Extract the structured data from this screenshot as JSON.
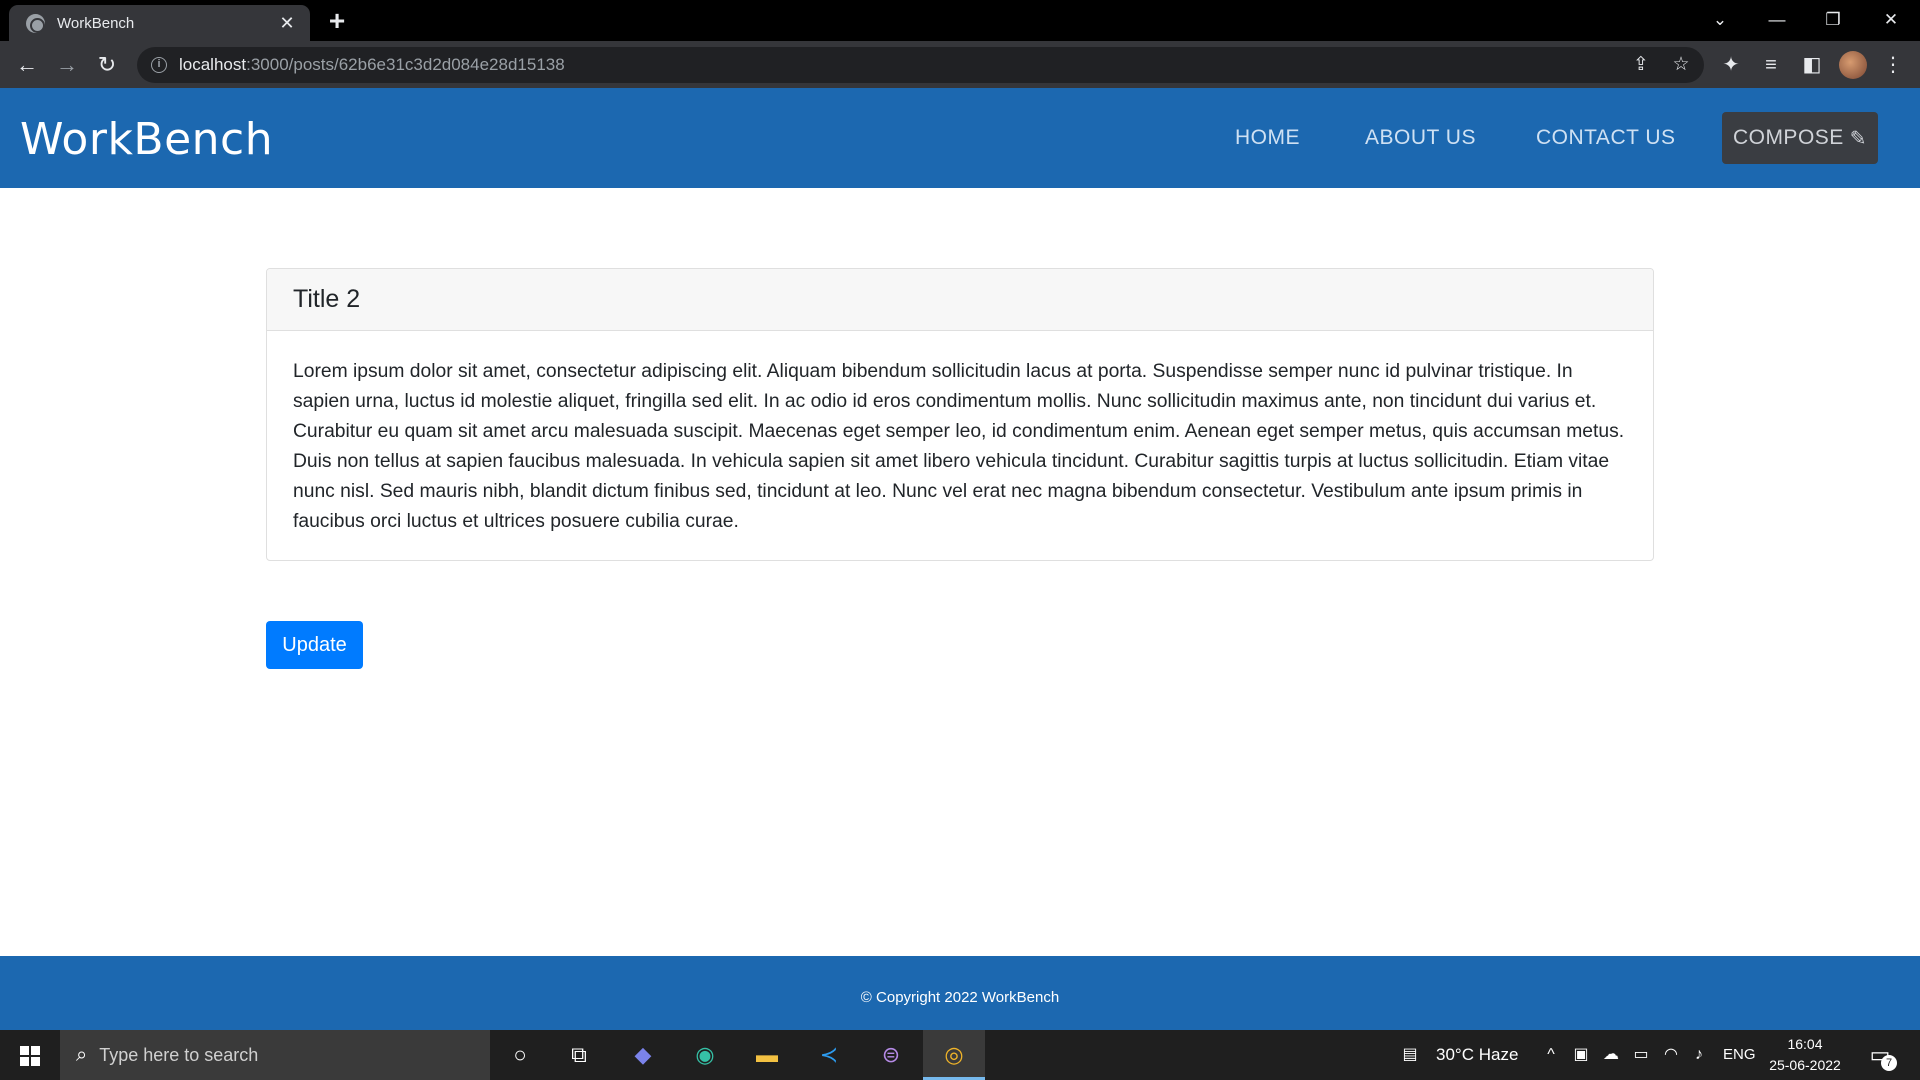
{
  "browser": {
    "tab_title": "WorkBench",
    "url_host": "localhost",
    "url_path": ":3000/posts/62b6e31c3d2d084e28d15138"
  },
  "navbar": {
    "brand": "WorkBench",
    "links": [
      "HOME",
      "ABOUT US",
      "CONTACT US"
    ],
    "compose_label": "COMPOSE",
    "color": "#1c68b0"
  },
  "post": {
    "title": "Title 2",
    "body": "Lorem ipsum dolor sit amet, consectetur adipiscing elit. Aliquam bibendum sollicitudin lacus at porta. Suspendisse semper nunc id pulvinar tristique. In sapien urna, luctus id molestie aliquet, fringilla sed elit. In ac odio id eros condimentum mollis. Nunc sollicitudin maximus ante, non tincidunt dui varius et. Curabitur eu quam sit amet arcu malesuada suscipit. Maecenas eget semper leo, id condimentum enim. Aenean eget semper metus, quis accumsan metus. Duis non tellus at sapien faucibus malesuada. In vehicula sapien sit amet libero vehicula tincidunt. Curabitur sagittis turpis at luctus sollicitudin. Etiam vitae nunc nisl. Sed mauris nibh, blandit dictum finibus sed, tincidunt at leo. Nunc vel erat nec magna bibendum consectetur. Vestibulum ante ipsum primis in faucibus orci luctus et ultrices posuere cubilia curae."
  },
  "update_label": "Update",
  "footer": {
    "copyright": "© Copyright 2022 WorkBench"
  },
  "taskbar": {
    "search_placeholder": "Type here to search",
    "weather": "30°C  Haze",
    "language": "ENG",
    "time": "16:04",
    "date": "25-06-2022",
    "notification_count": "7"
  }
}
